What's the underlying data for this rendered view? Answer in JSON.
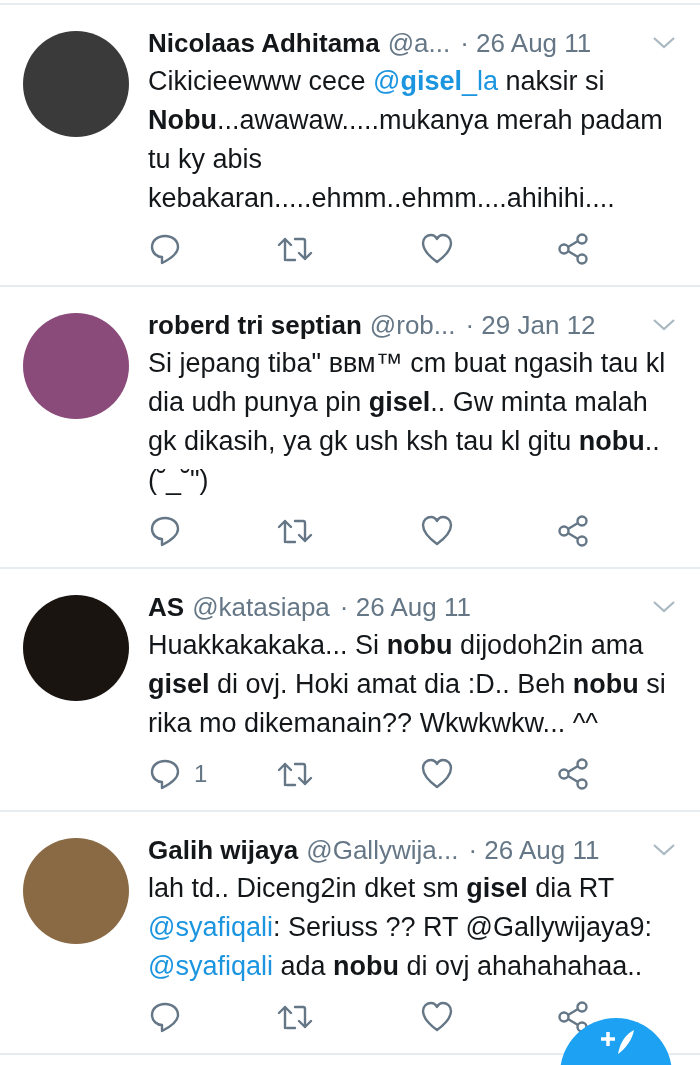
{
  "tweets": [
    {
      "name": "Nicolaas Adhitama",
      "handle": "@a...",
      "date": "· 26 Aug 11",
      "text": [
        {
          "kind": "plain",
          "text": "Cikicieewww cece "
        },
        {
          "kind": "mention",
          "text": "@**gisel**_la"
        },
        {
          "kind": "plain",
          "text": " naksir si "
        },
        {
          "kind": "bold",
          "text": "Nobu"
        },
        {
          "kind": "plain",
          "text": "...awawaw.....mukanya merah padam tu ky abis kebakaran.....ehmm..ehmm....ahihihi...."
        }
      ]
    },
    {
      "name": "roberd tri septian",
      "handle": "@rob...",
      "date": "· 29 Jan 12",
      "text": [
        {
          "kind": "plain",
          "text": "Si jepang tiba\" ввм™ cm buat ngasih tau kl dia udh punya pin "
        },
        {
          "kind": "bold",
          "text": "gisel"
        },
        {
          "kind": "plain",
          "text": ".. Gw minta malah gk dikasih, ya gk ush ksh tau kl gitu "
        },
        {
          "kind": "bold",
          "text": "nobu"
        },
        {
          "kind": "plain",
          "text": ".. (˘_˘\")"
        }
      ]
    },
    {
      "name": "AS",
      "handle": "@katasiapa",
      "date": "· 26 Aug 11",
      "reply_count": "1",
      "text": [
        {
          "kind": "plain",
          "text": "Huakkakakaka... Si "
        },
        {
          "kind": "bold",
          "text": "nobu"
        },
        {
          "kind": "plain",
          "text": " dijodoh2in ama "
        },
        {
          "kind": "bold",
          "text": "gisel"
        },
        {
          "kind": "plain",
          "text": " di ovj. Hoki amat dia :D.. Beh "
        },
        {
          "kind": "bold",
          "text": "nobu"
        },
        {
          "kind": "plain",
          "text": " si rika mo dikemanain?? Wkwkwkw... ^^"
        }
      ]
    },
    {
      "name": "Galih wijaya",
      "handle": "@Gallywija...",
      "date": "· 26 Aug 11",
      "text": [
        {
          "kind": "plain",
          "text": "lah td.. Diceng2in dket sm "
        },
        {
          "kind": "bold",
          "text": "gisel"
        },
        {
          "kind": "plain",
          "text": " dia RT "
        },
        {
          "kind": "mention",
          "text": "@syafiqali"
        },
        {
          "kind": "plain",
          "text": ": Seriuss ?? RT @Gallywijaya9: "
        },
        {
          "kind": "mention",
          "text": "@syafiqali"
        },
        {
          "kind": "plain",
          "text": " ada "
        },
        {
          "kind": "bold",
          "text": "nobu"
        },
        {
          "kind": "plain",
          "text": " di ovj ahahahahaa.."
        }
      ]
    }
  ]
}
